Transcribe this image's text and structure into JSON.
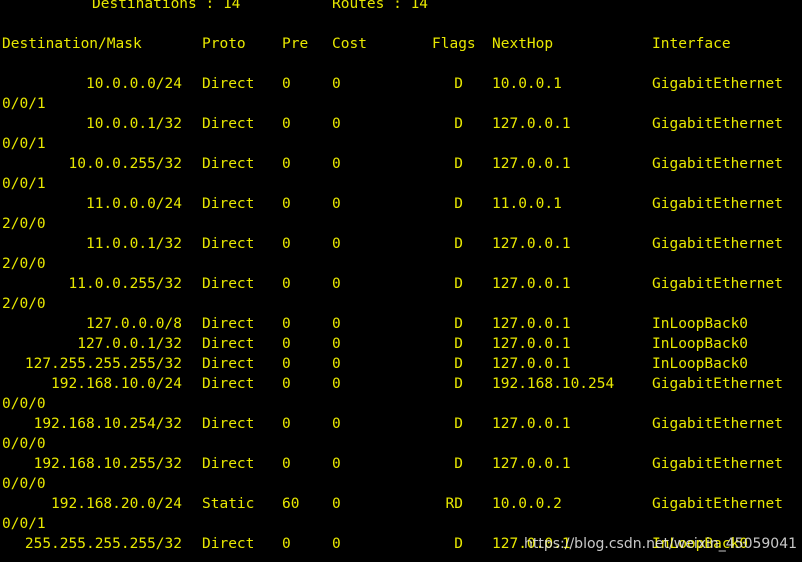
{
  "summary": {
    "destinations_label": "Destinations : 14",
    "routes_label": "Routes : 14"
  },
  "headers": {
    "dest_mask": "Destination/Mask",
    "proto": "Proto",
    "pre": "Pre",
    "cost": "Cost",
    "flags": "Flags",
    "nexthop": "NextHop",
    "interface": "Interface"
  },
  "routes": [
    {
      "dest": "10.0.0.0/24",
      "proto": "Direct",
      "pre": "0",
      "cost": "0",
      "flags": "D",
      "nexthop": "10.0.0.1",
      "iface": "GigabitEthernet",
      "iface_cont": "0/0/1"
    },
    {
      "dest": "10.0.0.1/32",
      "proto": "Direct",
      "pre": "0",
      "cost": "0",
      "flags": "D",
      "nexthop": "127.0.0.1",
      "iface": "GigabitEthernet",
      "iface_cont": "0/0/1"
    },
    {
      "dest": "10.0.0.255/32",
      "proto": "Direct",
      "pre": "0",
      "cost": "0",
      "flags": "D",
      "nexthop": "127.0.0.1",
      "iface": "GigabitEthernet",
      "iface_cont": "0/0/1"
    },
    {
      "dest": "11.0.0.0/24",
      "proto": "Direct",
      "pre": "0",
      "cost": "0",
      "flags": "D",
      "nexthop": "11.0.0.1",
      "iface": "GigabitEthernet",
      "iface_cont": "2/0/0"
    },
    {
      "dest": "11.0.0.1/32",
      "proto": "Direct",
      "pre": "0",
      "cost": "0",
      "flags": "D",
      "nexthop": "127.0.0.1",
      "iface": "GigabitEthernet",
      "iface_cont": "2/0/0"
    },
    {
      "dest": "11.0.0.255/32",
      "proto": "Direct",
      "pre": "0",
      "cost": "0",
      "flags": "D",
      "nexthop": "127.0.0.1",
      "iface": "GigabitEthernet",
      "iface_cont": "2/0/0"
    },
    {
      "dest": "127.0.0.0/8",
      "proto": "Direct",
      "pre": "0",
      "cost": "0",
      "flags": "D",
      "nexthop": "127.0.0.1",
      "iface": "InLoopBack0",
      "iface_cont": ""
    },
    {
      "dest": "127.0.0.1/32",
      "proto": "Direct",
      "pre": "0",
      "cost": "0",
      "flags": "D",
      "nexthop": "127.0.0.1",
      "iface": "InLoopBack0",
      "iface_cont": ""
    },
    {
      "dest": "127.255.255.255/32",
      "proto": "Direct",
      "pre": "0",
      "cost": "0",
      "flags": "D",
      "nexthop": "127.0.0.1",
      "iface": "InLoopBack0",
      "iface_cont": ""
    },
    {
      "dest": "192.168.10.0/24",
      "proto": "Direct",
      "pre": "0",
      "cost": "0",
      "flags": "D",
      "nexthop": "192.168.10.254",
      "iface": "GigabitEthernet",
      "iface_cont": "0/0/0"
    },
    {
      "dest": "192.168.10.254/32",
      "proto": "Direct",
      "pre": "0",
      "cost": "0",
      "flags": "D",
      "nexthop": "127.0.0.1",
      "iface": "GigabitEthernet",
      "iface_cont": "0/0/0"
    },
    {
      "dest": "192.168.10.255/32",
      "proto": "Direct",
      "pre": "0",
      "cost": "0",
      "flags": "D",
      "nexthop": "127.0.0.1",
      "iface": "GigabitEthernet",
      "iface_cont": "0/0/0"
    },
    {
      "dest": "192.168.20.0/24",
      "proto": "Static",
      "pre": "60",
      "cost": "0",
      "flags": "RD",
      "nexthop": "10.0.0.2",
      "iface": "GigabitEthernet",
      "iface_cont": "0/0/1"
    },
    {
      "dest": "255.255.255.255/32",
      "proto": "Direct",
      "pre": "0",
      "cost": "0",
      "flags": "D",
      "nexthop": "127.0.0.1",
      "iface": "InLoopBack0",
      "iface_cont": ""
    }
  ],
  "watermark": "https://blog.csdn.net/weixin_45059041",
  "colors": {
    "background": "#000000",
    "text": "#e8e800"
  }
}
